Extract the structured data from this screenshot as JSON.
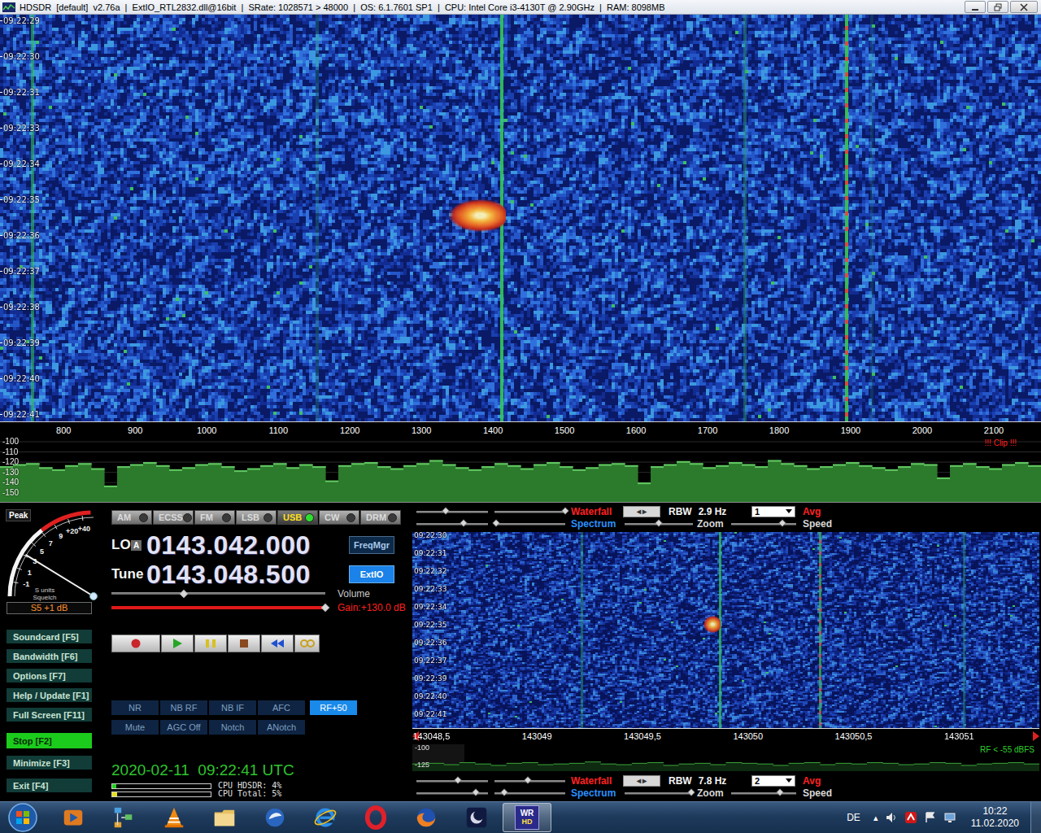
{
  "window": {
    "title": "HDSDR  [default]  v2.76a  |  ExtIO_RTL2832.dll@16bit  |  SRate: 1028571 > 48000  |  OS: 6.1.7601 SP1  |  CPU: Intel Core i3-4130T @ 2.90GHz  |  RAM: 8098MB"
  },
  "main_waterfall": {
    "time_labels": [
      "09:22:29",
      "09:22:30",
      "09:22:31",
      "09:22:33",
      "09:22:34",
      "09:22:35",
      "09:22:36",
      "09:22:37",
      "09:22:38",
      "09:22:39",
      "09:22:40",
      "09:22:41"
    ],
    "freq_range": [
      711,
      2166
    ],
    "freq_ticks": [
      "800",
      "900",
      "1000",
      "1100",
      "1200",
      "1300",
      "1400",
      "1500",
      "1600",
      "1700",
      "1800",
      "1900",
      "2000",
      "2100"
    ],
    "carriers": [
      {
        "freq": 756,
        "strength": 0.6,
        "color": "#2ec05a"
      },
      {
        "freq": 1154,
        "strength": 0.3,
        "color": "#2aa070"
      },
      {
        "freq": 1412,
        "strength": 0.9,
        "color": "#34c85a"
      },
      {
        "freq": 1752,
        "strength": 0.45,
        "color": "#2aa070"
      },
      {
        "freq": 1894,
        "strength": 0.95,
        "color": "#3cc050",
        "accent": "#e0502a"
      },
      {
        "freq": 1930,
        "strength": 0.2,
        "color": "#2aa070"
      }
    ],
    "signals": [
      {
        "freq_from": 1338,
        "freq_to": 1418,
        "t_from": 5.0,
        "t_to": 5.9,
        "level": 0.95
      }
    ]
  },
  "spectrum": {
    "db_ticks": [
      "-100",
      "-110",
      "-120",
      "-130",
      "-140",
      "-150"
    ],
    "db_range": [
      -96,
      -159
    ],
    "clip": "!!! Clip !!!",
    "values": [
      -124,
      -122,
      -121,
      -125,
      -127,
      -123,
      -121,
      -126,
      -143,
      -124,
      -122,
      -120,
      -123,
      -127,
      -125,
      -122,
      -121,
      -124,
      -128,
      -126,
      -123,
      -121,
      -125,
      -122,
      -124,
      -138,
      -123,
      -121,
      -120,
      -124,
      -126,
      -123,
      -121,
      -118,
      -122,
      -125,
      -127,
      -124,
      -121,
      -123,
      -126,
      -122,
      -120,
      -124,
      -127,
      -125,
      -122,
      -121,
      -123,
      -140,
      -124,
      -122,
      -119,
      -121,
      -125,
      -123,
      -120,
      -122,
      -124,
      -118,
      -121,
      -123,
      -126,
      -124,
      -122,
      -120,
      -123,
      -125,
      -127,
      -124,
      -121,
      -122,
      -135,
      -123,
      -121,
      -124,
      -126,
      -122,
      -120,
      -123
    ]
  },
  "smeter": {
    "mode": "Peak",
    "scale": [
      "-1",
      "1",
      "3",
      "5",
      "7",
      "9",
      "+20",
      "+40"
    ],
    "units": "S units",
    "squelch": "Squelch",
    "reading": "S5 +1 dB",
    "level": 0.35
  },
  "modes": [
    {
      "label": "AM",
      "selected": false
    },
    {
      "label": "ECSS",
      "selected": false
    },
    {
      "label": "FM",
      "selected": false
    },
    {
      "label": "LSB",
      "selected": false
    },
    {
      "label": "USB",
      "selected": true
    },
    {
      "label": "CW",
      "selected": false
    },
    {
      "label": "DRM",
      "selected": false
    }
  ],
  "lo": {
    "label": "LO",
    "badge": "A",
    "value": "0143.042.000",
    "button": "FreqMgr"
  },
  "tune": {
    "label": "Tune",
    "value": "0143.048.500",
    "button": "ExtIO"
  },
  "volume": {
    "label": "Volume",
    "level": 0.34
  },
  "gain": {
    "label": "Gain:+130.0 dB",
    "level": 1.0
  },
  "side_buttons": [
    {
      "label": "Soundcard [F5]",
      "active": false
    },
    {
      "label": "Bandwidth [F6]",
      "active": false
    },
    {
      "label": "Options [F7]",
      "active": false
    },
    {
      "label": "Help / Update [F1]",
      "active": false
    },
    {
      "label": "Full Screen [F11]",
      "active": false
    },
    {
      "label": "Stop [F2]",
      "active": true
    },
    {
      "label": "Minimize [F3]",
      "active": false
    },
    {
      "label": "Exit [F4]",
      "active": false
    }
  ],
  "transport": [
    {
      "kind": "record",
      "color": "#c8262a"
    },
    {
      "kind": "play",
      "color": "#26a626"
    },
    {
      "kind": "pause",
      "color": "#d8c020"
    },
    {
      "kind": "stop",
      "color": "#8a4a20"
    },
    {
      "kind": "rewind",
      "color": "#2050d0"
    },
    {
      "kind": "loop",
      "color": "#c8a020"
    }
  ],
  "dsp_rows": [
    [
      {
        "label": "NR",
        "on": false
      },
      {
        "label": "NB RF",
        "on": false
      },
      {
        "label": "NB IF",
        "on": false
      },
      {
        "label": "AFC",
        "on": false
      },
      {
        "label": "RF+50",
        "on": true
      }
    ],
    [
      {
        "label": "Mute",
        "on": false
      },
      {
        "label": "AGC Off",
        "on": false
      },
      {
        "label": "Notch",
        "on": false
      },
      {
        "label": "ANotch",
        "on": false
      }
    ]
  ],
  "clock": "2020-02-11  09:22:41 UTC",
  "cpu": [
    {
      "label": "CPU HDSDR: 4%",
      "level": 0.04,
      "color": "#22d022"
    },
    {
      "label": "CPU Total: 5%",
      "level": 0.05,
      "color": "#e8e020"
    }
  ],
  "settings_top": {
    "waterfall": "Waterfall",
    "arrows": [
      "◂",
      "▸"
    ],
    "rbw_label": "RBW",
    "rbw": "2.9 Hz",
    "avg_value": "1",
    "avg": "Avg",
    "spectrum": "Spectrum",
    "zoom": "Zoom",
    "speed": "Speed",
    "levels": {
      "wf_a": 0.41,
      "wf_b": 1.0,
      "sp_a": 0.66,
      "sp_b": 0.02,
      "zoom": 0.5,
      "speed": 0.79
    }
  },
  "zoom_waterfall": {
    "time_labels": [
      "09:22:30",
      "09:22:31",
      "09:22:32",
      "09:22:33",
      "09:22:34",
      "09:22:35",
      "09:22:36",
      "09:22:37",
      "09:22:39",
      "09:22:40",
      "09:22:41"
    ],
    "freq_range": [
      143048.41,
      143051.38
    ],
    "freq_ticks": [
      "143048,5",
      "143049",
      "143049,5",
      "143050",
      "143050,5",
      "143051"
    ],
    "carriers": [
      {
        "freq": 143049.21,
        "strength": 0.5,
        "color": "#2aa070"
      },
      {
        "freq": 143049.865,
        "strength": 0.75,
        "color": "#34c85a"
      },
      {
        "freq": 143050.34,
        "strength": 0.8,
        "color": "#3cb050",
        "accent": "#d06040"
      },
      {
        "freq": 143051.02,
        "strength": 0.45,
        "color": "#2aa070"
      }
    ],
    "signals": [
      {
        "freq_from": 143049.79,
        "freq_to": 143049.87,
        "t_from": 4.5,
        "t_to": 5.45,
        "level": 0.9
      }
    ]
  },
  "zoom_spectrum": {
    "db_ticks": [
      "-100",
      "-125"
    ],
    "db_range": [
      -95,
      -134
    ],
    "rf": "RF < -55 dBFS",
    "values": [
      -123,
      -122,
      -124,
      -121,
      -123,
      -125,
      -122,
      -121,
      -124,
      -123,
      -122,
      -120,
      -123,
      -124,
      -122,
      -121,
      -125,
      -123,
      -122,
      -124,
      -121,
      -122,
      -123,
      -125,
      -122,
      -121,
      -124,
      -122,
      -123,
      -121,
      -122,
      -124,
      -123,
      -121,
      -122,
      -125,
      -123,
      -122,
      -121,
      -123
    ]
  },
  "settings_bottom": {
    "waterfall": "Waterfall",
    "arrows": [
      "◂",
      "▸"
    ],
    "rbw_label": "RBW",
    "rbw": "7.8 Hz",
    "avg_value": "2",
    "avg": "Avg",
    "spectrum": "Spectrum",
    "zoom": "Zoom",
    "speed": "Speed",
    "levels": {
      "wf_a": 0.58,
      "wf_b": 0.47,
      "sp_a": 0.83,
      "sp_b": 0.14,
      "zoom": 0.98,
      "speed": 0.75
    }
  },
  "taskbar": {
    "apps": [
      {
        "kind": "media",
        "active": false
      },
      {
        "kind": "flowchart",
        "active": false
      },
      {
        "kind": "vlc",
        "active": false
      },
      {
        "kind": "folder",
        "active": false
      },
      {
        "kind": "mail",
        "active": false
      },
      {
        "kind": "ie",
        "active": false
      },
      {
        "kind": "opera",
        "active": false
      },
      {
        "kind": "firefox",
        "active": false
      },
      {
        "kind": "stellarium",
        "active": false
      },
      {
        "kind": "hdsdr",
        "label": "WR",
        "sub": "HD",
        "active": true
      }
    ],
    "language": "DE",
    "tray_expand": "▴",
    "time": "10:22",
    "date": "11.02.2020"
  }
}
